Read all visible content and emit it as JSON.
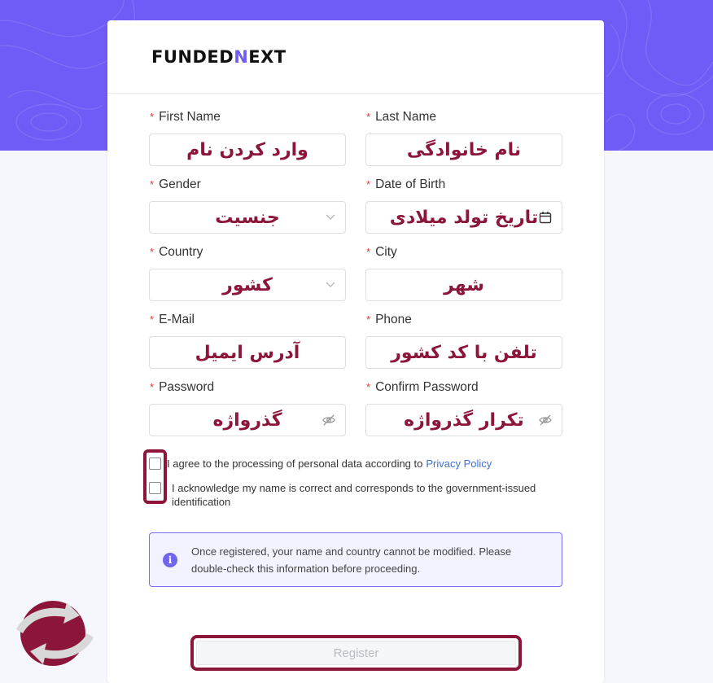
{
  "brand": {
    "logo_prefix": "FUNDED",
    "logo_accent": "N",
    "logo_suffix": "EXT",
    "accent_color": "#6f5cf6",
    "annotation_color": "#8c1639"
  },
  "form": {
    "first_name": {
      "label": "First Name",
      "placeholder": "وارد کردن نام"
    },
    "last_name": {
      "label": "Last Name",
      "placeholder": "نام خانوادگی"
    },
    "gender": {
      "label": "Gender",
      "placeholder": "جنسیت",
      "icon": "chevron-down-icon"
    },
    "date_of_birth": {
      "label": "Date of Birth",
      "placeholder": "تاریخ تولد میلادی",
      "icon": "calendar-icon"
    },
    "country": {
      "label": "Country",
      "placeholder": "کشور",
      "icon": "chevron-down-icon"
    },
    "city": {
      "label": "City",
      "placeholder": "شهر"
    },
    "email": {
      "label": "E-Mail",
      "placeholder": "آدرس ایمیل"
    },
    "phone": {
      "label": "Phone",
      "placeholder": "تلفن با کد کشور"
    },
    "password": {
      "label": "Password",
      "placeholder": "گذرواژه",
      "icon": "eye-off-icon"
    },
    "confirm_password": {
      "label": "Confirm Password",
      "placeholder": "تکرار گذرواژه",
      "icon": "eye-off-icon"
    },
    "required_mark": "*"
  },
  "consents": {
    "privacy_text": "I agree to the processing of personal data according to",
    "privacy_link": "Privacy Policy",
    "identity_text": "I acknowledge my name is correct and corresponds to the government-issued identification"
  },
  "notice": {
    "icon": "info-icon",
    "text": "Once registered, your name and country cannot be modified. Please double-check this information before proceeding."
  },
  "register_label": "Register"
}
